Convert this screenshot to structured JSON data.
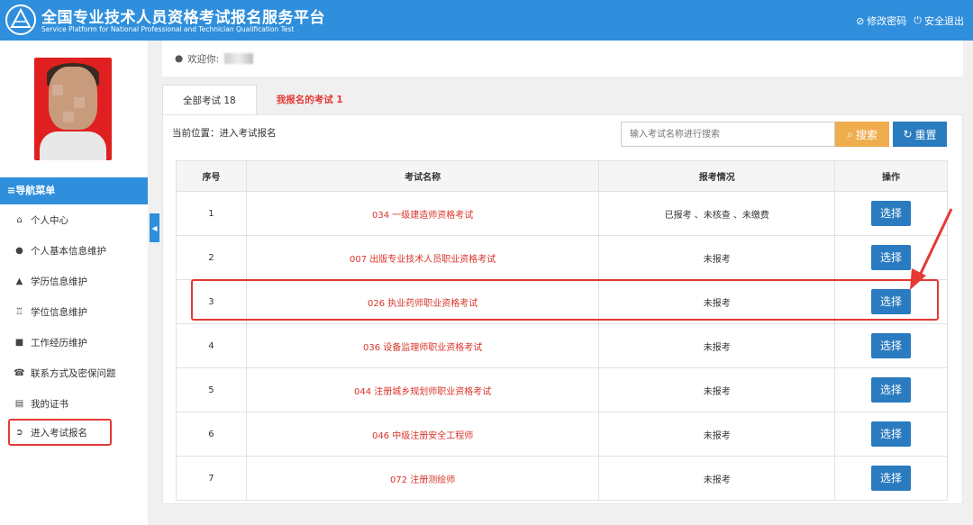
{
  "header": {
    "title_cn": "全国专业技术人员资格考试报名服务平台",
    "title_en": "Service Platform for National Professional and Technician Qualification Test",
    "change_password": "修改密码",
    "logout": "安全退出"
  },
  "sidebar": {
    "nav_title": "≡导航菜单",
    "items": [
      {
        "label": "个人中心",
        "icon": "home-icon"
      },
      {
        "label": "个人基本信息维护",
        "icon": "user-icon"
      },
      {
        "label": "学历信息维护",
        "icon": "graduation-cap-icon"
      },
      {
        "label": "学位信息维护",
        "icon": "degree-icon"
      },
      {
        "label": "工作经历维护",
        "icon": "briefcase-icon"
      },
      {
        "label": "联系方式及密保问题",
        "icon": "phone-icon"
      },
      {
        "label": "我的证书",
        "icon": "certificate-icon"
      },
      {
        "label": "进入考试报名",
        "icon": "arrow-circle-icon"
      }
    ]
  },
  "welcome": {
    "label": "欢迎你:"
  },
  "tabs": {
    "all": "全部考试 18",
    "mine": "我报名的考试 1"
  },
  "breadcrumb": "当前位置：进入考试报名",
  "search": {
    "placeholder": "输入考试名称进行搜索",
    "search_label": "搜索",
    "reset_label": "重置"
  },
  "table": {
    "headers": [
      "序号",
      "考试名称",
      "报考情况",
      "操作"
    ],
    "select_label": "选择",
    "rows": [
      {
        "no": "1",
        "name": "034 一级建造师资格考试",
        "status": "已报考 、未核查 、未缴费"
      },
      {
        "no": "2",
        "name": "007 出版专业技术人员职业资格考试",
        "status": "未报考"
      },
      {
        "no": "3",
        "name": "026 执业药师职业资格考试",
        "status": "未报考"
      },
      {
        "no": "4",
        "name": "036 设备监理师职业资格考试",
        "status": "未报考"
      },
      {
        "no": "5",
        "name": "044 注册城乡规划师职业资格考试",
        "status": "未报考"
      },
      {
        "no": "6",
        "name": "046 中级注册安全工程师",
        "status": "未报考"
      },
      {
        "no": "7",
        "name": "072 注册测绘师",
        "status": "未报考"
      }
    ]
  },
  "colors": {
    "primary": "#2f8fdc",
    "accent_red": "#e53935",
    "search_orange": "#f0ad4e",
    "button_blue": "#2a7bc0"
  }
}
